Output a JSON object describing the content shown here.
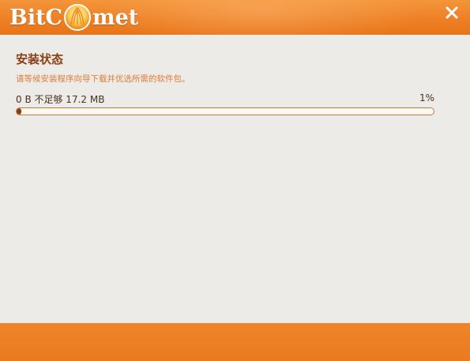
{
  "app": {
    "logo_prefix": "BitC",
    "logo_suffix": "met",
    "logo_full": "BitComet"
  },
  "titlebar": {
    "close_icon": "close-icon"
  },
  "install": {
    "heading": "安装状态",
    "description": "请等候安装程序向导下载并优选所需的软件包。",
    "status": "0 B 不足够 17.2 MB",
    "percent_label": "1%",
    "progress_fraction": 0.01
  },
  "colors": {
    "accent": "#ee8025",
    "heading": "#8a3e12",
    "subtext": "#de7b3a",
    "background": "#ecebe8"
  }
}
